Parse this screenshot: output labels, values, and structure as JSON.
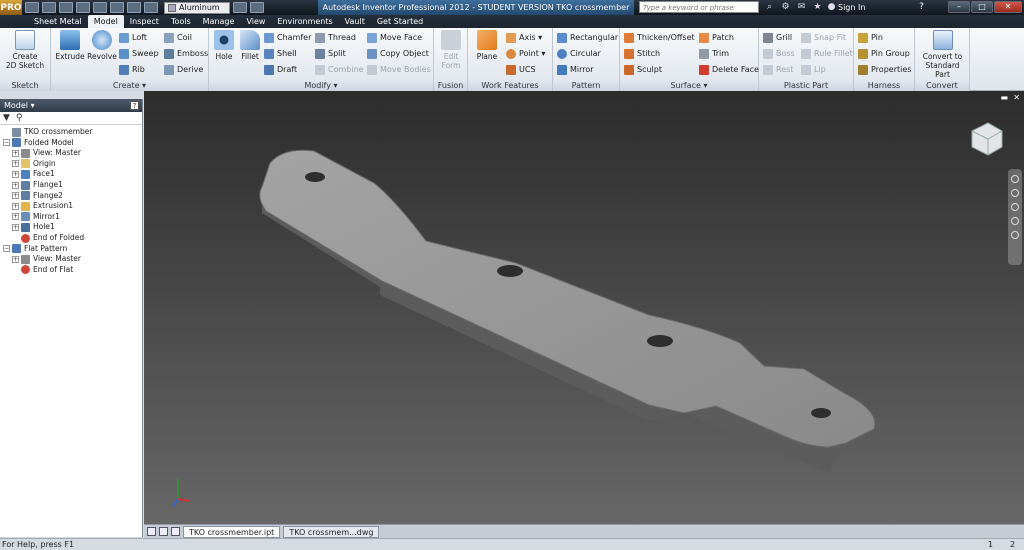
{
  "titlebar": {
    "logo_text": "PRO",
    "material": "Aluminum",
    "title": "Autodesk Inventor Professional 2012 - STUDENT VERSION   TKO crossmember",
    "search_placeholder": "Type a keyword or phrase",
    "sign_in": "Sign In",
    "help_glyph": "?",
    "min_glyph": "–",
    "max_glyph": "□",
    "close_glyph": "✕"
  },
  "tabs": [
    "Sheet Metal",
    "Model",
    "Inspect",
    "Tools",
    "Manage",
    "View",
    "Environments",
    "Vault",
    "Get Started"
  ],
  "active_tab_index": 1,
  "ribbon": {
    "sketch": {
      "label": "Sketch",
      "create_2d_sketch": "Create\n2D Sketch"
    },
    "create": {
      "label": "Create ▾",
      "extrude": "Extrude",
      "revolve": "Revolve",
      "loft": "Loft",
      "sweep": "Sweep",
      "rib": "Rib",
      "coil": "Coil",
      "emboss": "Emboss",
      "derive": "Derive"
    },
    "modify": {
      "label": "Modify ▾",
      "hole": "Hole",
      "fillet": "Fillet",
      "chamfer": "Chamfer",
      "shell": "Shell",
      "draft": "Draft",
      "thread": "Thread",
      "split": "Split",
      "combine": "Combine",
      "move_face": "Move Face",
      "copy_object": "Copy Object",
      "move_bodies": "Move Bodies"
    },
    "fusion": {
      "label": "Fusion",
      "edit_form": "Edit\nForm"
    },
    "work_features": {
      "label": "Work Features",
      "plane": "Plane",
      "axis": "Axis ▾",
      "point": "Point ▾",
      "ucs": "UCS"
    },
    "pattern": {
      "label": "Pattern",
      "rectangular": "Rectangular",
      "circular": "Circular",
      "mirror": "Mirror"
    },
    "surface": {
      "label": "Surface ▾",
      "thicken_offset": "Thicken/Offset",
      "stitch": "Stitch",
      "sculpt": "Sculpt",
      "patch": "Patch",
      "trim": "Trim",
      "delete_face": "Delete Face"
    },
    "plastic_part": {
      "label": "Plastic Part",
      "grill": "Grill",
      "boss": "Boss",
      "rest": "Rest",
      "snap_fit": "Snap Fit",
      "rule_fillet": "Rule Fillet",
      "lip": "Lip"
    },
    "harness": {
      "label": "Harness",
      "pin": "Pin",
      "pin_group": "Pin Group",
      "properties": "Properties"
    },
    "convert": {
      "label": "Convert",
      "convert_to_standard": "Convert to\nStandard Part"
    }
  },
  "browser": {
    "header": "Model ▾",
    "help": "?",
    "tree": [
      {
        "label": "TKO crossmember",
        "level": 0,
        "toggle": "",
        "icon": "part-icon"
      },
      {
        "label": "Folded Model",
        "level": 0,
        "toggle": "−",
        "icon": "folded-model-icon"
      },
      {
        "label": "View: Master",
        "level": 1,
        "toggle": "+",
        "icon": "view-icon"
      },
      {
        "label": "Origin",
        "level": 1,
        "toggle": "+",
        "icon": "folder-icon"
      },
      {
        "label": "Face1",
        "level": 1,
        "toggle": "+",
        "icon": "face-icon"
      },
      {
        "label": "Flange1",
        "level": 1,
        "toggle": "+",
        "icon": "flange-icon"
      },
      {
        "label": "Flange2",
        "level": 1,
        "toggle": "+",
        "icon": "flange-icon"
      },
      {
        "label": "Extrusion1",
        "level": 1,
        "toggle": "+",
        "icon": "extrusion-icon"
      },
      {
        "label": "Mirror1",
        "level": 1,
        "toggle": "+",
        "icon": "mirror-icon"
      },
      {
        "label": "Hole1",
        "level": 1,
        "toggle": "+",
        "icon": "hole-icon"
      },
      {
        "label": "End of Folded",
        "level": 1,
        "toggle": "",
        "icon": "end-marker-icon"
      },
      {
        "label": "Flat Pattern",
        "level": 0,
        "toggle": "−",
        "icon": "flat-pattern-icon"
      },
      {
        "label": "View: Master",
        "level": 1,
        "toggle": "+",
        "icon": "view-icon"
      },
      {
        "label": "End of Flat",
        "level": 1,
        "toggle": "",
        "icon": "end-marker-icon"
      }
    ]
  },
  "viewport": {
    "viewcube_label": "FRONT",
    "min_glyph": "▬",
    "close_glyph": "✕"
  },
  "doc_tabs": [
    "TKO crossmember.ipt",
    "TKO crossmem...dwg"
  ],
  "status": {
    "help": "For Help, press F1",
    "n1": "1",
    "n2": "2"
  },
  "colors": {
    "part_surface": "#8e8e8e",
    "ribbon_bg": "#e8edf3",
    "titlebar_bg": "#1d2631"
  }
}
